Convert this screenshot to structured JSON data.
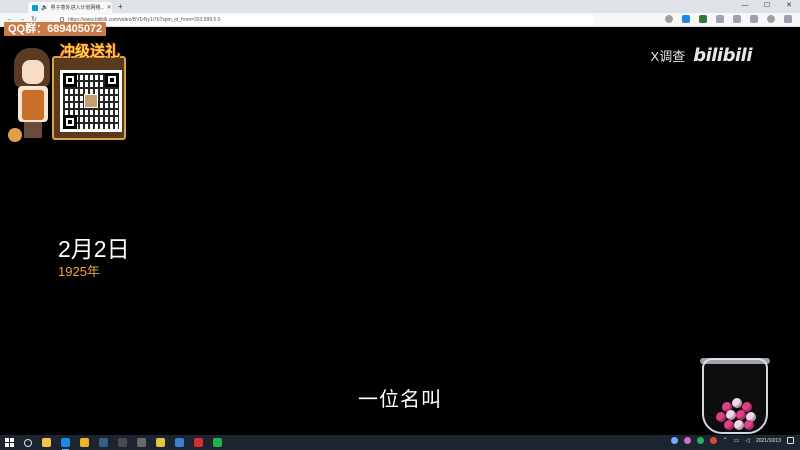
{
  "browser": {
    "tab_title": "男子意外进入计划网络...",
    "url": "https://www.bilibili.com/video/BV1rNy1i7b?spm_id_from=333.999.0.0",
    "new_tab_label": "+",
    "minimize_label": "—",
    "maximize_label": "☐",
    "close_label": "✕",
    "back_label": "←",
    "forward_label": "→",
    "refresh_label": "↻"
  },
  "video": {
    "qq_group_text": "QQ群：689405072",
    "promo_title": "冲级送礼",
    "watermark_prefix": "X调查",
    "watermark_logo": "bilibili",
    "date_main": "2月2日",
    "date_year": "1925年",
    "subtitle": "一位名叫"
  },
  "taskbar": {
    "apps": [
      {
        "name": "file-explorer",
        "color": "#f3c44b"
      },
      {
        "name": "edge-browser",
        "color": "#1e88e5",
        "active": true
      },
      {
        "name": "folder",
        "color": "#f0b429"
      },
      {
        "name": "steam",
        "color": "#3b5d84"
      },
      {
        "name": "obs",
        "color": "#4a4a4a"
      },
      {
        "name": "terminal",
        "color": "#6a6a6a"
      },
      {
        "name": "app-yellow",
        "color": "#e4c53a"
      },
      {
        "name": "app-blue",
        "color": "#3f7fd0"
      },
      {
        "name": "netease-music",
        "color": "#d62f2f"
      },
      {
        "name": "wechat",
        "color": "#21b14e"
      }
    ],
    "clock_time": "",
    "clock_date": "2021/10/13"
  },
  "colors": {
    "accent_orange": "#f0a03c",
    "qq_banner": "#c97b4a",
    "taskbar_bg": "#1c2430"
  }
}
